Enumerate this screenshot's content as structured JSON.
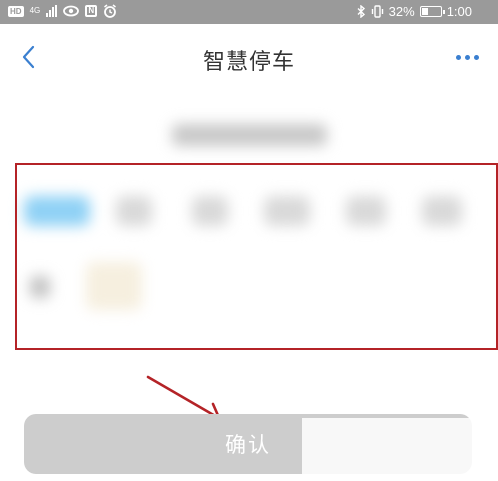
{
  "status_bar": {
    "left_badge": "HD",
    "network": "4G",
    "battery_percent": "32%",
    "time": "1:00"
  },
  "header": {
    "title": "智慧停车",
    "back_icon": "chevron-left-icon",
    "more_icon": "more-horizontal-icon"
  },
  "main": {
    "confirm_label": "确认",
    "highlight_color": "#b42327",
    "arrow_color": "#b42327",
    "accent_color": "#3a7fd0",
    "active_slot_color": "#8fd1f5"
  }
}
